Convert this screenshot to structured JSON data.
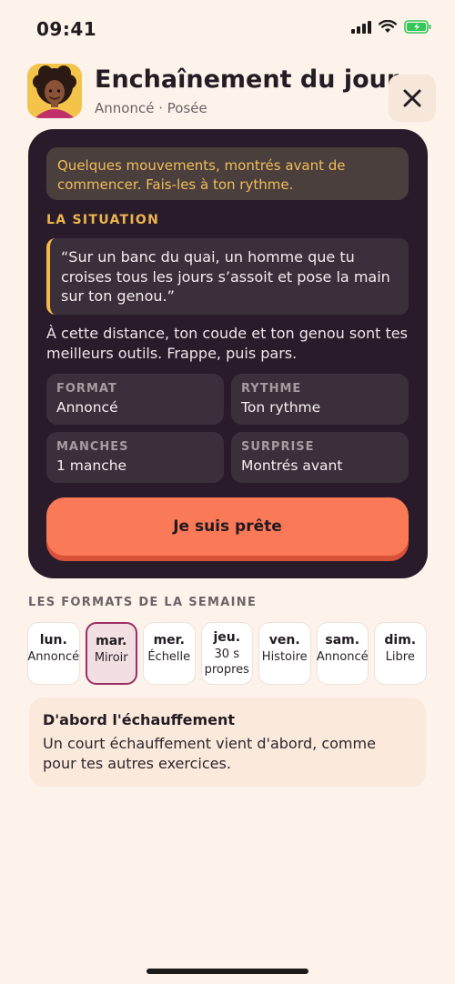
{
  "status_bar": {
    "time": "09:41"
  },
  "header": {
    "title": "Enchaînement du jour",
    "subtitle": "Annoncé · Posée",
    "avatar_icon": "coach-avatar-icon",
    "close_icon": "close-icon"
  },
  "card": {
    "intro": "Quelques mouvements, montrés avant de commencer. Fais-les à ton rythme.",
    "situation_label": "LA SITUATION",
    "quote": "“Sur un banc du quai, un homme que tu croises tous les jours s’assoit et pose la main sur ton genou.”",
    "situation_text": "À cette distance, ton coude et ton genou sont tes meilleurs outils. Frappe, puis pars.",
    "tiles": [
      {
        "label": "FORMAT",
        "value": "Annoncé"
      },
      {
        "label": "RYTHME",
        "value": "Ton rythme"
      },
      {
        "label": "MANCHES",
        "value": "1 manche"
      },
      {
        "label": "SURPRISE",
        "value": "Montrés avant"
      }
    ],
    "cta_label": "Je suis prête"
  },
  "week": {
    "label": "LES FORMATS DE LA SEMAINE",
    "days": [
      {
        "day": "lun.",
        "format": "Annoncé"
      },
      {
        "day": "mar.",
        "format": "Miroir",
        "selected": true
      },
      {
        "day": "mer.",
        "format": "Échelle"
      },
      {
        "day": "jeu.",
        "format": "30 s propres"
      },
      {
        "day": "ven.",
        "format": "Histoire"
      },
      {
        "day": "sam.",
        "format": "Annoncé"
      },
      {
        "day": "dim.",
        "format": "Libre"
      }
    ]
  },
  "warmup": {
    "title": "D'abord l'échauffement",
    "text": "Un court échauffement vient d'abord, comme pour tes autres exercices."
  },
  "colors": {
    "background": "#fdf3ea",
    "card": "#2a1b2b",
    "accent_gold": "#f2b94d",
    "cta": "#fa7a57",
    "selected_border": "#9b2f63"
  }
}
